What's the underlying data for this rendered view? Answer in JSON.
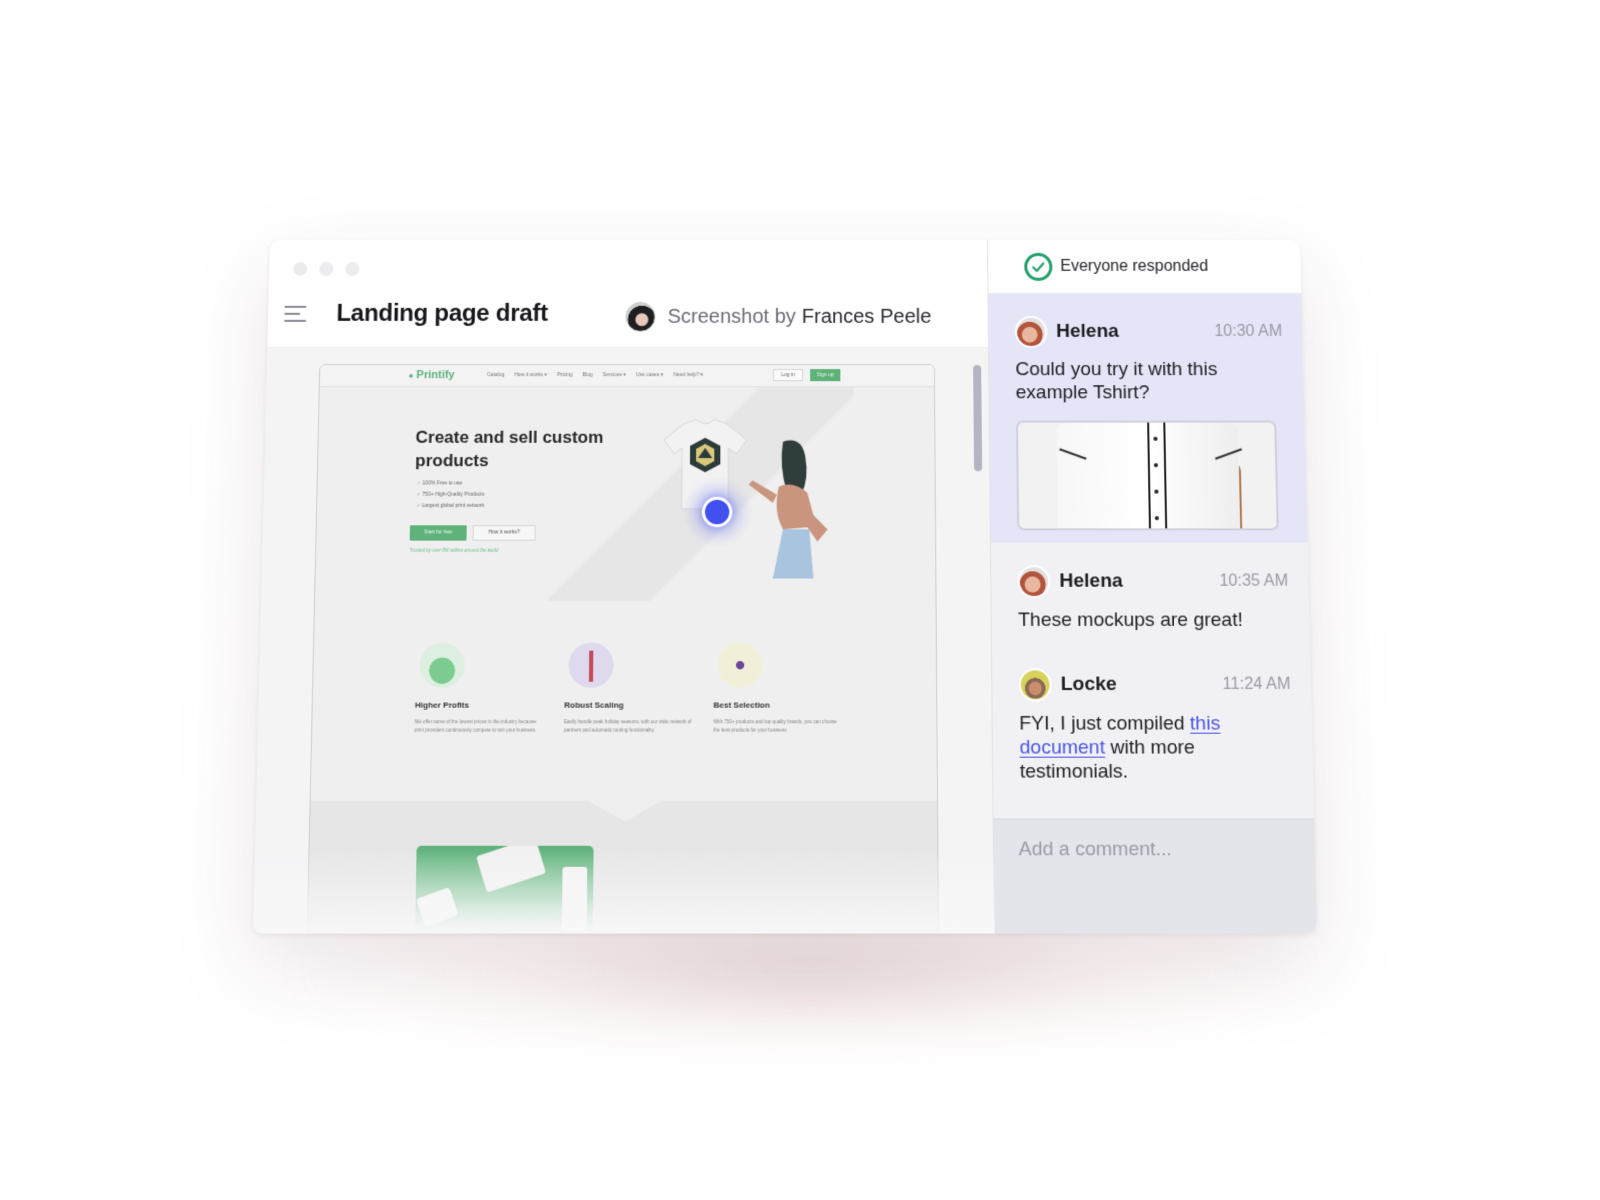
{
  "window": {
    "title": "Landing page draft",
    "author_prefix": "Screenshot by",
    "author_name": "Frances Peele"
  },
  "screenshot": {
    "logo": "Printify",
    "nav_links": [
      "Catalog",
      "How it works ▾",
      "Pricing",
      "Blog",
      "Services ▾",
      "Use cases ▾",
      "Need help? ▾"
    ],
    "login_label": "Log in",
    "signup_label": "Sign up",
    "hero_title": "Create and sell custom products",
    "hero_checks": [
      "100% Free to use",
      "750+ High-Quality Products",
      "Largest global print network"
    ],
    "start_button": "Start for free",
    "how_button": "How it works?",
    "trusted_text": "Trusted by over 8M sellers around the world",
    "features": [
      {
        "title": "Higher Profits",
        "desc": "We offer some of the lowest prices in the industry because print providers continuously compete to win your business."
      },
      {
        "title": "Robust Scaling",
        "desc": "Easily handle peak holiday seasons, with our wide network of partners and automatic routing functionality."
      },
      {
        "title": "Best Selection",
        "desc": "With 750+ products and top quality brands, you can choose the best products for your business."
      }
    ]
  },
  "comments_panel": {
    "status": "Everyone responded",
    "status_color": "#24a06a",
    "comments": [
      {
        "author": "Helena",
        "time": "10:30 AM",
        "text": "Could you try it with this example Tshirt?",
        "has_attachment": true
      },
      {
        "author": "Helena",
        "time": "10:35 AM",
        "text": "These mockups are great!"
      },
      {
        "author": "Locke",
        "time": "11:24 AM",
        "text_before": "FYI, I just compiled ",
        "link_text": "this document",
        "text_after": " with more testimonials."
      }
    ],
    "input_placeholder": "Add a comment...",
    "link_color": "#4a55e0",
    "cursor_color": "#4250f0"
  }
}
